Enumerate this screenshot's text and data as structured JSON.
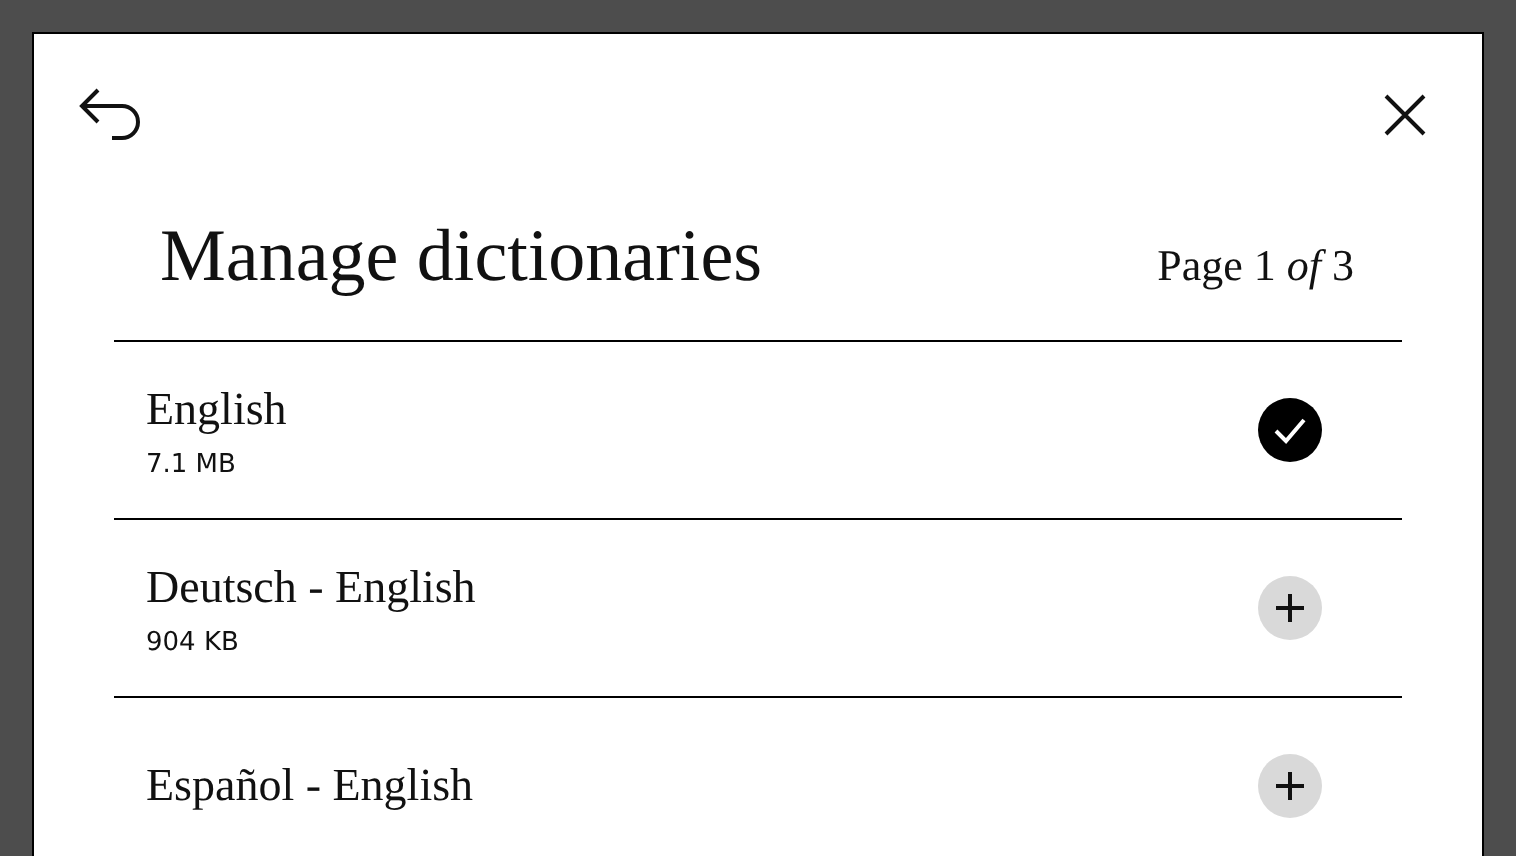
{
  "title": "Manage dictionaries",
  "page_indicator": "Page 1 *of* 3",
  "dictionaries": [
    {
      "name": "English",
      "size": "7.1 MB",
      "installed": true
    },
    {
      "name": "Deutsch - English",
      "size": "904 KB",
      "installed": false
    },
    {
      "name": "Español - English",
      "installed": false
    }
  ]
}
